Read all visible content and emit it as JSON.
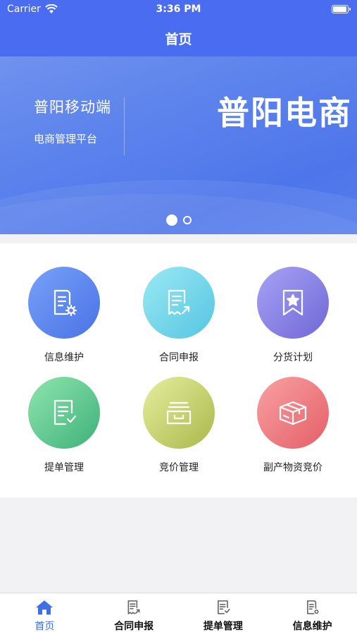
{
  "status_bar": {
    "carrier": "Carrier",
    "time": "3:36 PM",
    "battery_level": 1.0
  },
  "nav": {
    "title": "首页"
  },
  "banner": {
    "subtitle": "普阳移动端",
    "caption": "电商管理平台",
    "brand": "普阳电商",
    "slide_count": 2,
    "active_slide": 1
  },
  "grid": {
    "items": [
      {
        "label": "信息维护",
        "icon": "document-gear-icon",
        "color": "#4a72e6"
      },
      {
        "label": "合同申报",
        "icon": "receipt-arrow-icon",
        "color": "#55c5e2"
      },
      {
        "label": "分货计划",
        "icon": "bookmark-star-icon",
        "color": "#6f67d6"
      },
      {
        "label": "提单管理",
        "icon": "document-check-icon",
        "color": "#3fb07a"
      },
      {
        "label": "竞价管理",
        "icon": "inbox-tray-icon",
        "color": "#a9b84a"
      },
      {
        "label": "副产物资竞价",
        "icon": "package-box-icon",
        "color": "#e35f66"
      }
    ]
  },
  "tabs": [
    {
      "label": "首页",
      "icon": "home-icon",
      "active": true
    },
    {
      "label": "合同申报",
      "icon": "receipt-arrow-icon",
      "active": false
    },
    {
      "label": "提单管理",
      "icon": "document-check-icon",
      "active": false
    },
    {
      "label": "信息维护",
      "icon": "document-gear-icon",
      "active": false
    }
  ],
  "colors": {
    "primary": "#4a6cf0",
    "tab_active": "#3f6fe6"
  }
}
